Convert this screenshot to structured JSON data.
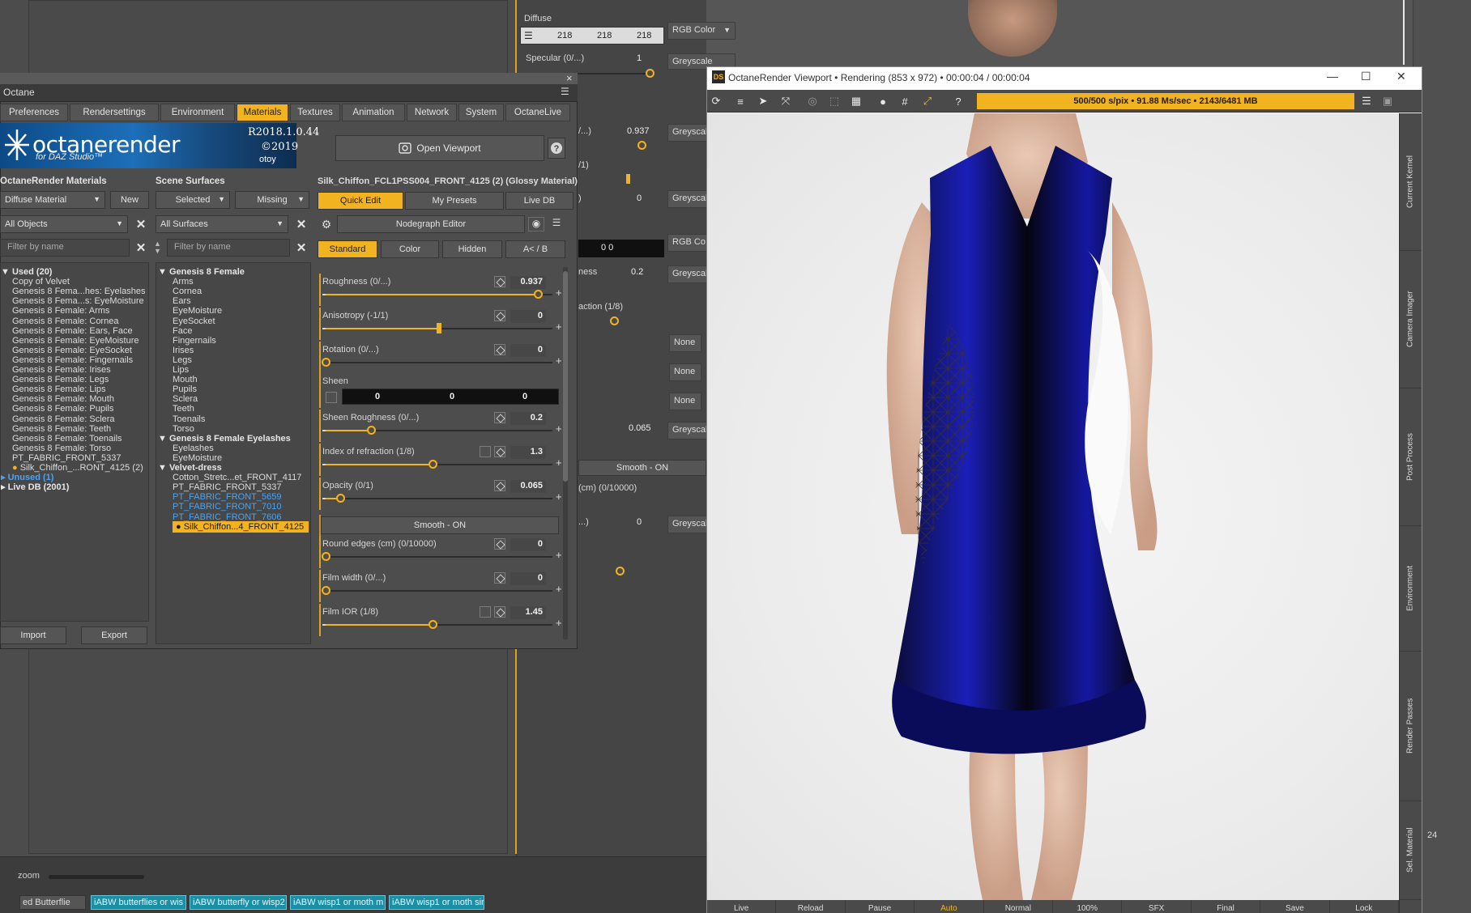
{
  "background": {
    "diffuse_label": "Diffuse",
    "diffuse_values": [
      "218",
      "218",
      "218"
    ],
    "diffuse_type": "RGB Color",
    "specular_label": "Specular (0/...)",
    "specular_value": "1",
    "specular_type": "Greyscale",
    "rows": [
      {
        "label": "/...)",
        "value": "0.937",
        "type": "Greyscale"
      },
      {
        "label": "/1)",
        "value": "",
        "type": ""
      },
      {
        "label": ")",
        "value": "0",
        "type": "Greyscale"
      },
      {
        "label": "",
        "value": "0   0",
        "type": "RGB Co"
      },
      {
        "label": "ness",
        "value": "0.2",
        "type": "Greyscale"
      },
      {
        "label": "action (1/8)",
        "value": "",
        "type": ""
      },
      {
        "label": "",
        "value": "",
        "type": "None"
      },
      {
        "label": "",
        "value": "",
        "type": "None"
      },
      {
        "label": "",
        "value": "",
        "type": "None"
      },
      {
        "label": "",
        "value": "0.065",
        "type": "Greyscale"
      }
    ],
    "smooth_label": "Smooth - ON",
    "round_label": "(cm) (0/10000)",
    "row_last_label": "...)",
    "row_last_value": "0",
    "row_last_type": "Greyscale",
    "far_number": "24"
  },
  "timeline": {
    "zoom_label": "zoom",
    "select_value": "ed Butterflie",
    "clips": [
      "iABW butterflies or wis",
      "iABW butterfly or wisp2",
      "iABW wisp1 or moth m",
      "iABW wisp1 or moth sin"
    ]
  },
  "octane": {
    "title": "Octane",
    "close": "×",
    "tabs": [
      {
        "label": "Preferences",
        "active": false
      },
      {
        "label": "Rendersettings",
        "active": false
      },
      {
        "label": "Environment",
        "active": false
      },
      {
        "label": "Materials",
        "active": true
      },
      {
        "label": "Textures",
        "active": false
      },
      {
        "label": "Animation",
        "active": false
      },
      {
        "label": "Network",
        "active": false
      },
      {
        "label": "System",
        "active": false
      },
      {
        "label": "OctaneLive",
        "active": false
      }
    ],
    "banner": {
      "logo": "octanerender",
      "sub": "for DAZ Studio™",
      "version": "R2018.1.0.44",
      "year": "©2019",
      "company": "otoy"
    },
    "open_viewport_label": "Open Viewport",
    "materials": {
      "title": "OctaneRender Materials",
      "type_value": "Diffuse Material",
      "new_label": "New",
      "filter_objects": "All Objects",
      "filter_placeholder": "Filter by name",
      "items": [
        {
          "text": "Used (20)",
          "style": "bold",
          "prefix": "▼"
        },
        {
          "text": "Copy of Velvet",
          "style": ""
        },
        {
          "text": "Genesis 8 Fema...hes: Eyelashes",
          "style": ""
        },
        {
          "text": "Genesis 8 Fema...s: EyeMoisture",
          "style": ""
        },
        {
          "text": "Genesis 8 Female: Arms",
          "style": ""
        },
        {
          "text": "Genesis 8 Female: Cornea",
          "style": ""
        },
        {
          "text": "Genesis 8 Female: Ears, Face",
          "style": ""
        },
        {
          "text": "Genesis 8 Female: EyeMoisture",
          "style": ""
        },
        {
          "text": "Genesis 8 Female: EyeSocket",
          "style": ""
        },
        {
          "text": "Genesis 8 Female: Fingernails",
          "style": ""
        },
        {
          "text": "Genesis 8 Female: Irises",
          "style": ""
        },
        {
          "text": "Genesis 8 Female: Legs",
          "style": ""
        },
        {
          "text": "Genesis 8 Female: Lips",
          "style": ""
        },
        {
          "text": "Genesis 8 Female: Mouth",
          "style": ""
        },
        {
          "text": "Genesis 8 Female: Pupils",
          "style": ""
        },
        {
          "text": "Genesis 8 Female: Sclera",
          "style": ""
        },
        {
          "text": "Genesis 8 Female: Teeth",
          "style": ""
        },
        {
          "text": "Genesis 8 Female: Toenails",
          "style": ""
        },
        {
          "text": "Genesis 8 Female: Torso",
          "style": ""
        },
        {
          "text": "PT_FABRIC_FRONT_5337",
          "style": ""
        },
        {
          "text": "Silk_Chiffon_...RONT_4125 (2)",
          "style": "",
          "dot": true
        },
        {
          "text": "Unused (1)",
          "style": "blue-bold",
          "prefix": "▸"
        },
        {
          "text": "Live DB (2001)",
          "style": "bold",
          "prefix": "▸"
        }
      ],
      "import_label": "Import",
      "export_label": "Export"
    },
    "surfaces": {
      "title": "Scene Surfaces",
      "selected_label": "Selected",
      "missing_label": "Missing",
      "filter_surfaces": "All Surfaces",
      "filter_placeholder": "Filter by name",
      "items": [
        {
          "text": "Genesis 8 Female",
          "style": "bold",
          "prefix": "▼",
          "indent": 0
        },
        {
          "text": "Arms",
          "style": "",
          "indent": 1
        },
        {
          "text": "Cornea",
          "style": "",
          "indent": 1
        },
        {
          "text": "Ears",
          "style": "",
          "indent": 1
        },
        {
          "text": "EyeMoisture",
          "style": "",
          "indent": 1
        },
        {
          "text": "EyeSocket",
          "style": "",
          "indent": 1
        },
        {
          "text": "Face",
          "style": "",
          "indent": 1
        },
        {
          "text": "Fingernails",
          "style": "",
          "indent": 1
        },
        {
          "text": "Irises",
          "style": "",
          "indent": 1
        },
        {
          "text": "Legs",
          "style": "",
          "indent": 1
        },
        {
          "text": "Lips",
          "style": "",
          "indent": 1
        },
        {
          "text": "Mouth",
          "style": "",
          "indent": 1
        },
        {
          "text": "Pupils",
          "style": "",
          "indent": 1
        },
        {
          "text": "Sclera",
          "style": "",
          "indent": 1
        },
        {
          "text": "Teeth",
          "style": "",
          "indent": 1
        },
        {
          "text": "Toenails",
          "style": "",
          "indent": 1
        },
        {
          "text": "Torso",
          "style": "",
          "indent": 1
        },
        {
          "text": "Genesis 8 Female Eyelashes",
          "style": "bold",
          "prefix": "▼",
          "indent": 0
        },
        {
          "text": "Eyelashes",
          "style": "",
          "indent": 1
        },
        {
          "text": "EyeMoisture",
          "style": "",
          "indent": 1
        },
        {
          "text": "Velvet-dress",
          "style": "bold",
          "prefix": "▼",
          "indent": 0
        },
        {
          "text": "Cotton_Stretc...et_FRONT_4117",
          "style": "",
          "indent": 1
        },
        {
          "text": "PT_FABRIC_FRONT_5337",
          "style": "",
          "indent": 1
        },
        {
          "text": "PT_FABRIC_FRONT_5659",
          "style": "blue",
          "indent": 1
        },
        {
          "text": "PT_FABRIC_FRONT_7010",
          "style": "blue",
          "indent": 1
        },
        {
          "text": "PT_FABRIC_FRONT_7606",
          "style": "blue",
          "indent": 1
        },
        {
          "text": "Silk_Chiffon...4_FRONT_4125",
          "style": "sel",
          "indent": 1,
          "dot": true
        }
      ]
    },
    "editor": {
      "title": "Silk_Chiffon_FCL1PSS004_FRONT_4125 (2) (Glossy Material)",
      "tabs": [
        "Quick Edit",
        "My Presets",
        "Live DB"
      ],
      "nodegraph_label": "Nodegraph Editor",
      "modes": [
        "Standard",
        "Color",
        "Hidden",
        "A< / B"
      ],
      "params": [
        {
          "label": "Roughness (0/...)",
          "value": "0.937",
          "level": 0.937,
          "list": false
        },
        {
          "label": "Anisotropy (-1/1)",
          "value": "0",
          "level": 0.5,
          "list": false,
          "bar": true
        },
        {
          "label": "Rotation (0/...)",
          "value": "0",
          "level": 0,
          "list": false
        },
        {
          "label": "Sheen Roughness (0/...)",
          "value": "0.2",
          "level": 0.2,
          "list": false
        },
        {
          "label": "Index of refraction (1/8)",
          "value": "1.3",
          "level": 0.47,
          "list": true
        },
        {
          "label": "Opacity (0/1)",
          "value": "0.065",
          "level": 0.065,
          "list": false
        },
        {
          "label": "Round edges (cm) (0/10000)",
          "value": "0",
          "level": 0,
          "list": false
        },
        {
          "label": "Film width (0/...)",
          "value": "0",
          "level": 0,
          "list": false
        },
        {
          "label": "Film IOR (1/8)",
          "value": "1.45",
          "level": 0.47,
          "list": true
        }
      ],
      "sheen_label": "Sheen",
      "sheen_values": [
        "0",
        "0",
        "0"
      ],
      "smooth_label": "Smooth - ON"
    }
  },
  "viewport": {
    "title": "OctaneRender Viewport • Rendering (853 x 972) • 00:00:04 / 00:00:04",
    "ds_badge": "DS",
    "status": "500/500 s/pix • 91.88 Ms/sec • 2143/6481 MB",
    "side_tabs": [
      "Current Kernel",
      "Camera Imager",
      "Post Process",
      "Environment",
      "Render Passes",
      "Sel. Material"
    ],
    "bottom_buttons": [
      "Live",
      "Reload",
      "Pause",
      "Auto",
      "Normal",
      "100%",
      "SFX",
      "Final",
      "Save",
      "Lock"
    ],
    "active_bottom": "Auto",
    "colors": {
      "accent": "#f2b320",
      "dress_blue": "#1a1fb8"
    }
  }
}
